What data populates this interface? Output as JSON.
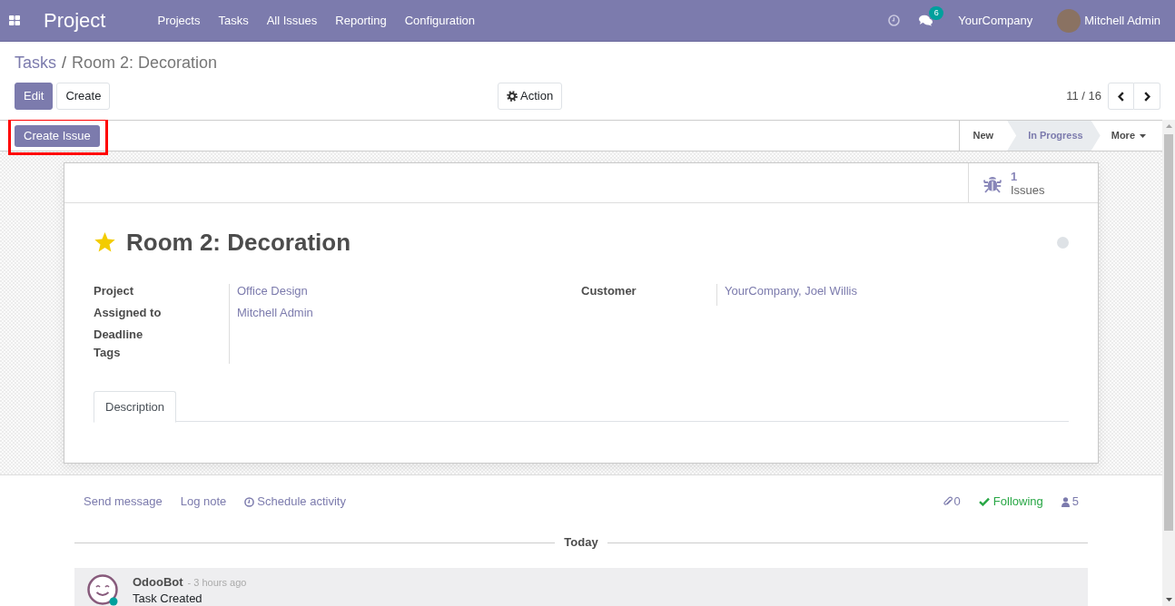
{
  "navbar": {
    "app_title": "Project",
    "menu": [
      "Projects",
      "Tasks",
      "All Issues",
      "Reporting",
      "Configuration"
    ],
    "message_count": "6",
    "company": "YourCompany",
    "user": "Mitchell Admin"
  },
  "breadcrumb": {
    "items": [
      {
        "label": "Tasks",
        "kind": "link"
      },
      {
        "label": "Room 2: Decoration",
        "kind": "current"
      }
    ],
    "separator": "/"
  },
  "buttons": [
    {
      "label": "Edit",
      "kind": "primary"
    },
    {
      "label": "Create",
      "kind": "secondary"
    }
  ],
  "action_button": "Action",
  "pager": {
    "position": "11 / 16"
  },
  "statusbar": {
    "create_button": {
      "label": "Create Issue",
      "highlighted": true
    },
    "stages": [
      {
        "label": "New",
        "selected": false
      },
      {
        "label": "In Progress",
        "selected": true
      }
    ],
    "more": "More"
  },
  "smart_button": {
    "count": "1",
    "label": "Issues"
  },
  "task": {
    "title": "Room 2: Decoration",
    "starred": true,
    "fields_left": [
      {
        "label": "Project",
        "value": "Office Design"
      },
      {
        "label": "Assigned to",
        "value": "Mitchell Admin"
      },
      {
        "label": "Deadline"
      },
      {
        "label": "Tags"
      }
    ],
    "fields_right": [
      {
        "label": "Customer",
        "value": "YourCompany, Joel Willis"
      }
    ]
  },
  "tabs": [
    {
      "label": "Description",
      "selected": true
    }
  ],
  "chatter": {
    "actions": [
      {
        "label": "Send message",
        "kind": "text"
      },
      {
        "label": "Log note",
        "kind": "text"
      },
      {
        "label": "Schedule activity",
        "kind": "activity"
      }
    ],
    "attachments": "0",
    "follow_label": "Following",
    "following": true,
    "followers": "5",
    "date_divider": "Today",
    "messages": [
      {
        "author": "OdooBot",
        "time": "- 3 hours ago",
        "body": "Task Created"
      }
    ]
  }
}
